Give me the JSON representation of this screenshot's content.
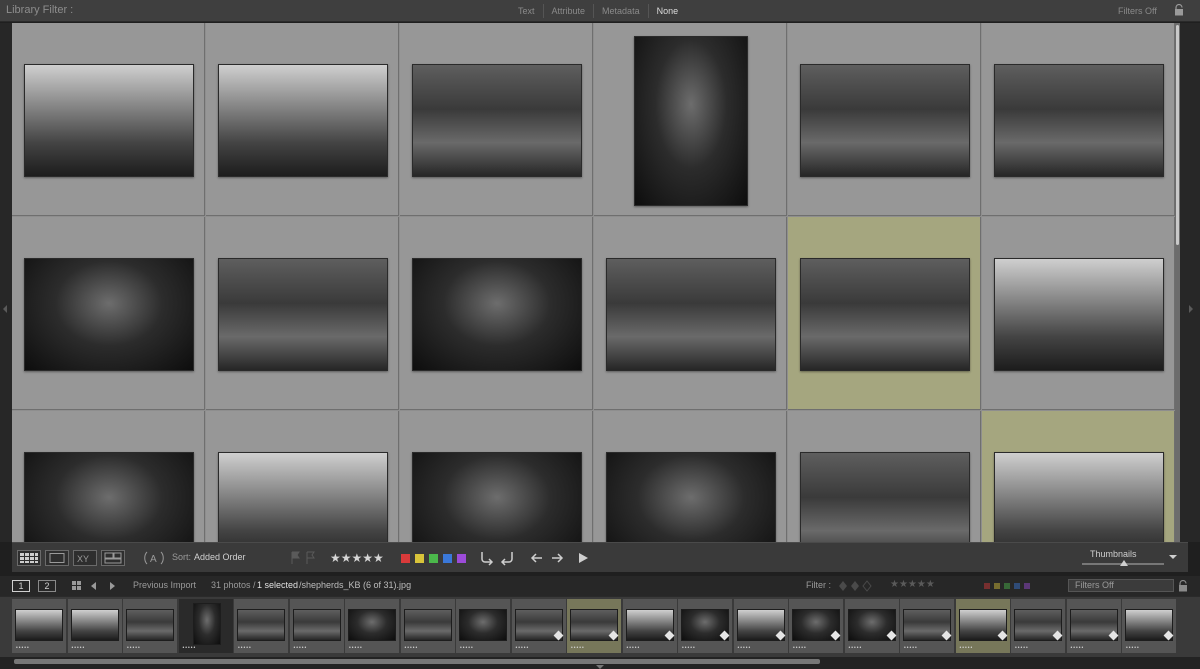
{
  "filter_bar": {
    "title": "Library Filter :",
    "modes": [
      "Text",
      "Attribute",
      "Metadata",
      "None"
    ],
    "active_mode": "None",
    "filters_off": "Filters Off"
  },
  "grid": {
    "rows": [
      [
        {
          "tone": "bright",
          "orientation": "landscape",
          "highlight": false
        },
        {
          "tone": "bright",
          "orientation": "landscape",
          "highlight": false
        },
        {
          "tone": "mid",
          "orientation": "landscape",
          "highlight": false
        },
        {
          "tone": "dark",
          "orientation": "portrait",
          "highlight": false
        },
        {
          "tone": "mid",
          "orientation": "landscape",
          "highlight": false
        },
        {
          "tone": "mid",
          "orientation": "landscape",
          "highlight": false
        }
      ],
      [
        {
          "tone": "dark",
          "orientation": "landscape",
          "highlight": false
        },
        {
          "tone": "mid",
          "orientation": "landscape",
          "highlight": false
        },
        {
          "tone": "dark",
          "orientation": "landscape",
          "highlight": false
        },
        {
          "tone": "mid",
          "orientation": "landscape",
          "highlight": false
        },
        {
          "tone": "mid",
          "orientation": "landscape",
          "highlight": true
        },
        {
          "tone": "bright",
          "orientation": "landscape",
          "highlight": false
        }
      ],
      [
        {
          "tone": "dark",
          "orientation": "landscape",
          "highlight": false
        },
        {
          "tone": "bright",
          "orientation": "landscape",
          "highlight": false
        },
        {
          "tone": "dark",
          "orientation": "landscape",
          "highlight": false
        },
        {
          "tone": "dark",
          "orientation": "landscape",
          "highlight": false
        },
        {
          "tone": "mid",
          "orientation": "landscape",
          "highlight": false
        },
        {
          "tone": "bright",
          "orientation": "landscape",
          "highlight": true
        }
      ]
    ]
  },
  "toolbar": {
    "sort_label": "Sort:",
    "sort_value": "Added Order",
    "stars": "★★★★★",
    "colors": [
      "#d93a3a",
      "#d9c43a",
      "#4bb84b",
      "#3a78d9",
      "#9c4bd9"
    ],
    "thumbnails_label": "Thumbnails"
  },
  "film_header": {
    "screen1": "1",
    "screen2": "2",
    "source": "Previous Import",
    "count": "31 photos /",
    "selected": "1 selected",
    "file": "/shepherds_KB (6 of 31).jpg",
    "filter_label": "Filter :",
    "filters_off": "Filters Off"
  },
  "filmstrip": [
    {
      "tone": "bright",
      "state": "normal"
    },
    {
      "tone": "bright",
      "state": "normal"
    },
    {
      "tone": "mid",
      "state": "normal"
    },
    {
      "tone": "dark",
      "state": "selected"
    },
    {
      "tone": "mid",
      "state": "normal"
    },
    {
      "tone": "mid",
      "state": "normal"
    },
    {
      "tone": "dark",
      "state": "normal"
    },
    {
      "tone": "mid",
      "state": "normal"
    },
    {
      "tone": "dark",
      "state": "normal"
    },
    {
      "tone": "mid",
      "state": "normal"
    },
    {
      "tone": "mid",
      "state": "highlight"
    },
    {
      "tone": "bright",
      "state": "normal"
    },
    {
      "tone": "dark",
      "state": "normal"
    },
    {
      "tone": "bright",
      "state": "normal"
    },
    {
      "tone": "dark",
      "state": "normal"
    },
    {
      "tone": "dark",
      "state": "normal"
    },
    {
      "tone": "mid",
      "state": "normal"
    },
    {
      "tone": "bright",
      "state": "highlight"
    },
    {
      "tone": "mid",
      "state": "normal"
    },
    {
      "tone": "mid",
      "state": "normal"
    },
    {
      "tone": "bright",
      "state": "normal"
    }
  ],
  "rating_dots": "•••••"
}
